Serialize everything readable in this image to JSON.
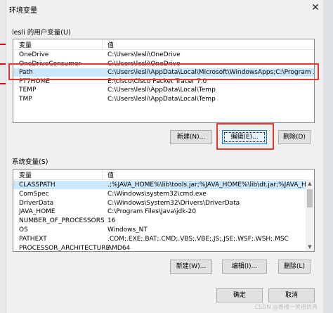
{
  "window": {
    "title": "环境变量",
    "close_glyph": "✕"
  },
  "user_vars": {
    "label": "lesli 的用户变量(U)",
    "col_variable": "变量",
    "col_value": "值",
    "rows": [
      {
        "name": "OneDrive",
        "value": "C:\\Users\\lesli\\OneDrive"
      },
      {
        "name": "OneDriveConsumer",
        "value": "C:\\Users\\lesli\\OneDrive"
      },
      {
        "name": "Path",
        "value": "C:\\Users\\lesli\\AppData\\Local\\Microsoft\\WindowsApps;C:\\Program ..."
      },
      {
        "name": "PT7HOME",
        "value": "E:\\cisco\\Cisco Packet Tracer 7.0"
      },
      {
        "name": "TEMP",
        "value": "C:\\Users\\lesli\\AppData\\Local\\Temp"
      },
      {
        "name": "TMP",
        "value": "C:\\Users\\lesli\\AppData\\Local\\Temp"
      }
    ],
    "buttons": {
      "new": "新建(N)...",
      "edit": "编辑(E)...",
      "delete": "删除(D)"
    }
  },
  "system_vars": {
    "label": "系统变量(S)",
    "col_variable": "变量",
    "col_value": "值",
    "rows": [
      {
        "name": "CLASSPATH",
        "value": ".;%JAVA_HOME%\\lib\\tools.jar;%JAVA_HOME%\\lib\\dt.jar;%JAVA_H..."
      },
      {
        "name": "ComSpec",
        "value": "C:\\Windows\\system32\\cmd.exe"
      },
      {
        "name": "DriverData",
        "value": "C:\\Windows\\System32\\Drivers\\DriverData"
      },
      {
        "name": "JAVA_HOME",
        "value": "C:\\Program Files\\Java\\jdk-20"
      },
      {
        "name": "NUMBER_OF_PROCESSORS",
        "value": "16"
      },
      {
        "name": "OS",
        "value": "Windows_NT"
      },
      {
        "name": "PATHEXT",
        "value": ".COM;.EXE;.BAT;.CMD;.VBS;.VBE;.JS;.JSE;.WSF;.WSH;.MSC"
      },
      {
        "name": "PROCESSOR_ARCHITECTURE",
        "value": "AMD64"
      }
    ],
    "buttons": {
      "new": "新建(W)...",
      "edit": "编辑(I)...",
      "delete": "删除(L)"
    }
  },
  "footer": {
    "ok": "确定",
    "cancel": "取消"
  },
  "watermark": "CSDN @香橙一笑很优秀",
  "colors": {
    "selected_row": "#cce8ff",
    "highlight_box": "#e53935",
    "focus_border": "#0078d7"
  }
}
